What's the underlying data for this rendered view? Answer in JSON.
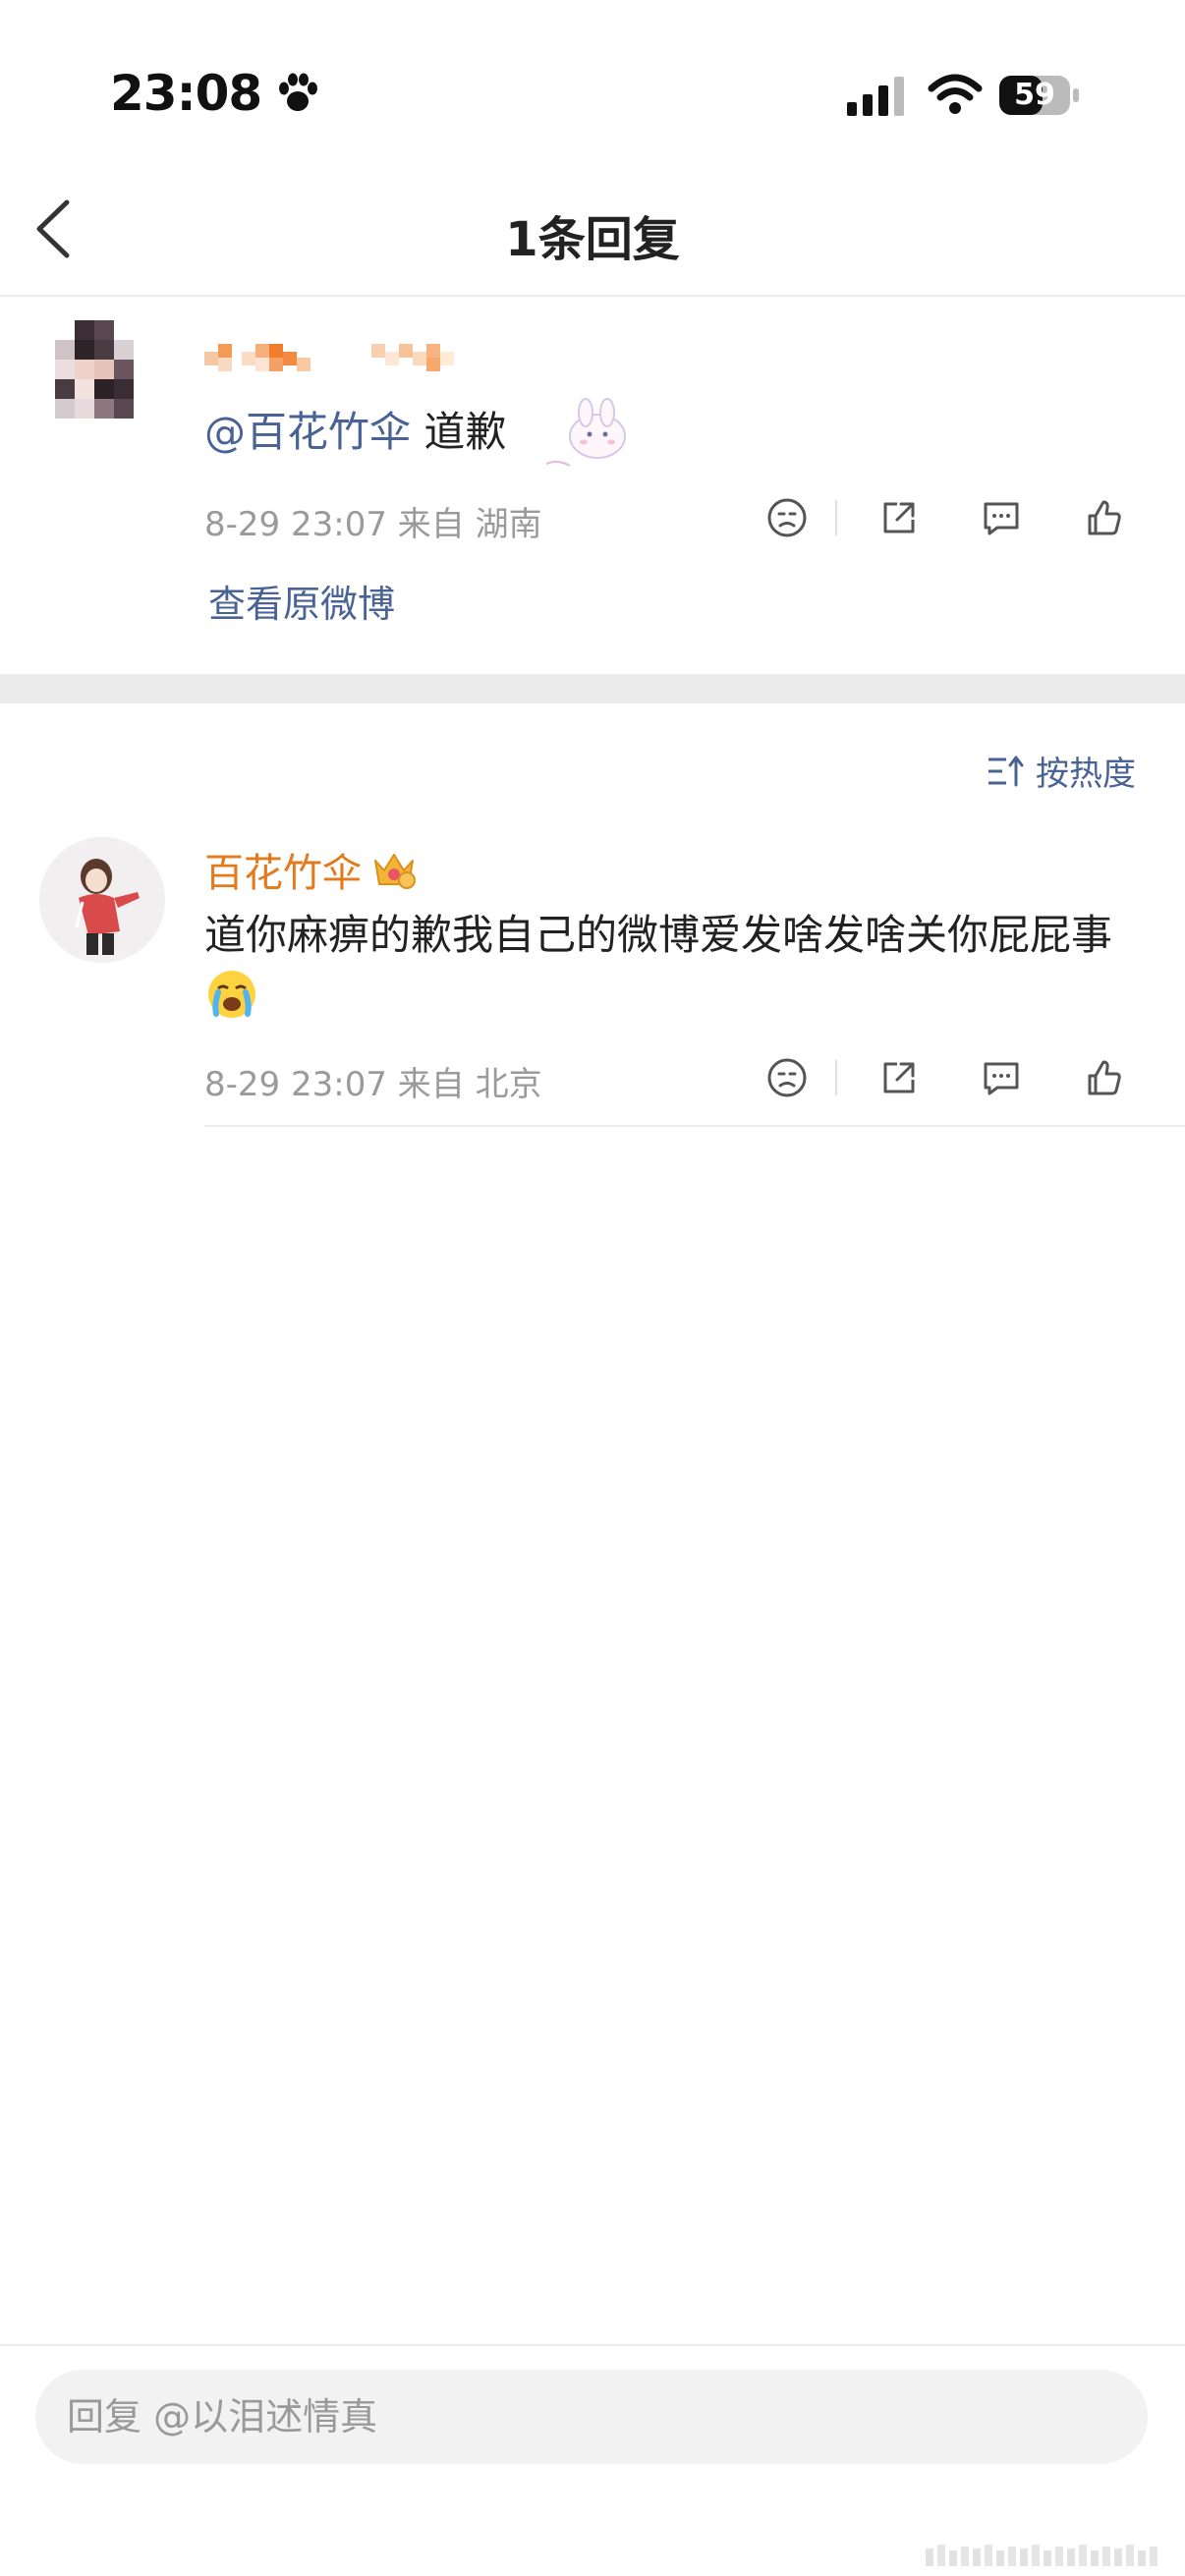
{
  "status_bar": {
    "time": "23:08",
    "battery": "59"
  },
  "nav": {
    "title": "1条回复",
    "back_icon": "chevron-left-icon"
  },
  "top_comment": {
    "mention": "@百花竹伞",
    "text": "道歉",
    "meta": "8-29 23:07  来自 湖南",
    "view_original": "查看原微博"
  },
  "sort": {
    "label": "按热度"
  },
  "reply": {
    "username": "百花竹伞",
    "username_color": "#e47a1b",
    "text": "道你麻痹的歉我自己的微博爱发啥发啥关你屁屁事",
    "meta": "8-29 23:07  来自 北京"
  },
  "input": {
    "placeholder": "回复 @以泪述情真"
  },
  "colors": {
    "link": "#4a6396",
    "meta": "#9a9a9a",
    "divider": "#ececec"
  }
}
